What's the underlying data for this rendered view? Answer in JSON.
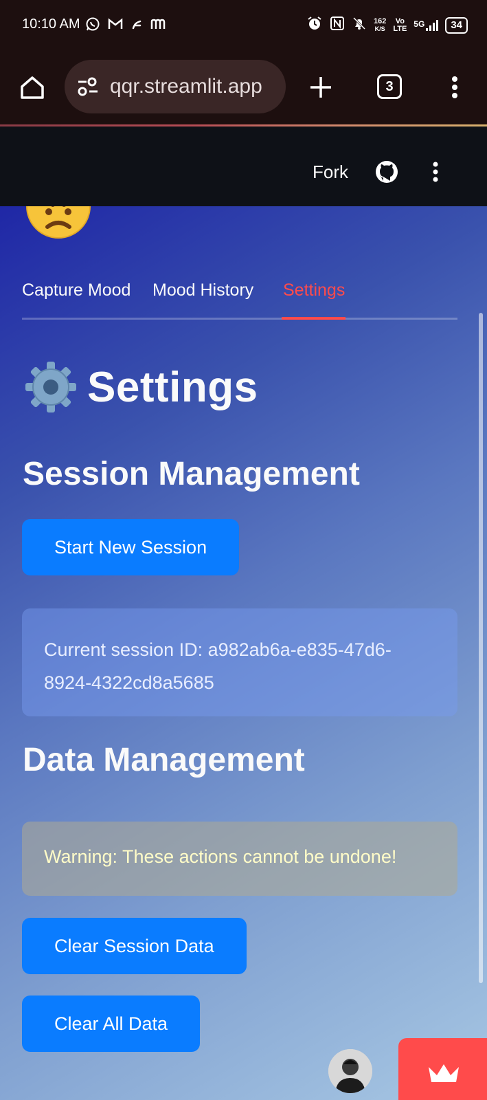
{
  "status_bar": {
    "time": "10:10 AM",
    "left_icons": [
      "whatsapp-icon",
      "gmail-icon",
      "fitbit-icon",
      "m-app-icon"
    ],
    "net_speed_value": "162",
    "net_speed_unit": "K/S",
    "volte_top": "Vo",
    "volte_bottom": "LTE",
    "network": "5G",
    "battery": "34"
  },
  "browser": {
    "url": "qqr.streamlit.app",
    "tab_count": "3"
  },
  "header": {
    "fork_label": "Fork"
  },
  "tabs": [
    {
      "label": "Capture Mood",
      "active": false
    },
    {
      "label": "Mood History",
      "active": false
    },
    {
      "label": "Settings",
      "active": true
    }
  ],
  "page": {
    "title": "Settings",
    "session_heading": "Session Management",
    "start_session_label": "Start New Session",
    "session_info": "Current session ID: a982ab6a-e835-47d6-8924-4322cd8a5685",
    "data_heading": "Data Management",
    "warning_text": "Warning: These actions cannot be undone!",
    "clear_session_label": "Clear Session Data",
    "clear_all_label": "Clear All Data"
  },
  "colors": {
    "accent": "#ff4b4b",
    "button": "#0a7cff",
    "header_bg": "#0e1117"
  }
}
